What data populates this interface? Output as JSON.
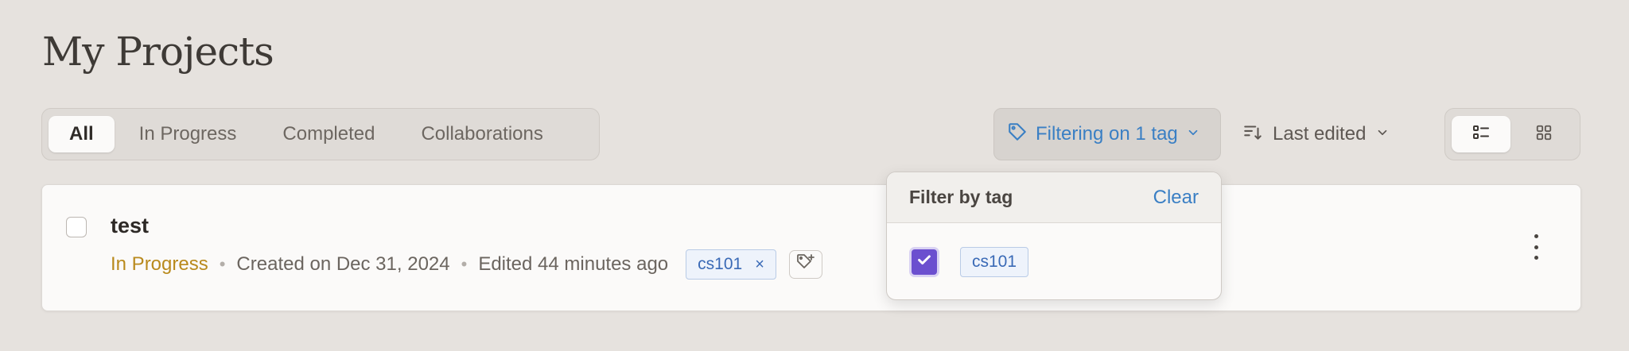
{
  "page": {
    "title": "My Projects"
  },
  "tabs": [
    {
      "label": "All",
      "active": true
    },
    {
      "label": "In Progress",
      "active": false
    },
    {
      "label": "Completed",
      "active": false
    },
    {
      "label": "Collaborations",
      "active": false
    }
  ],
  "toolbar": {
    "filter_label": "Filtering on 1 tag",
    "sort_label": "Last edited"
  },
  "project": {
    "title": "test",
    "status": "In Progress",
    "created": "Created on Dec 31, 2024",
    "edited": "Edited 44 minutes ago",
    "tag": "cs101",
    "tag_remove": "×"
  },
  "filter_dropdown": {
    "title": "Filter by tag",
    "clear_label": "Clear",
    "options": [
      {
        "label": "cs101",
        "checked": true
      }
    ]
  },
  "colors": {
    "accent_blue": "#3a7fc4",
    "status_in_progress": "#b98a1d",
    "checkbox_purple": "#6b4fcf",
    "background": "#e6e2de"
  },
  "icons": [
    "tag-icon",
    "chevron-down-icon",
    "sort-icon",
    "list-view-icon",
    "grid-view-icon",
    "add-tag-icon",
    "more-vertical-icon",
    "check-icon"
  ]
}
